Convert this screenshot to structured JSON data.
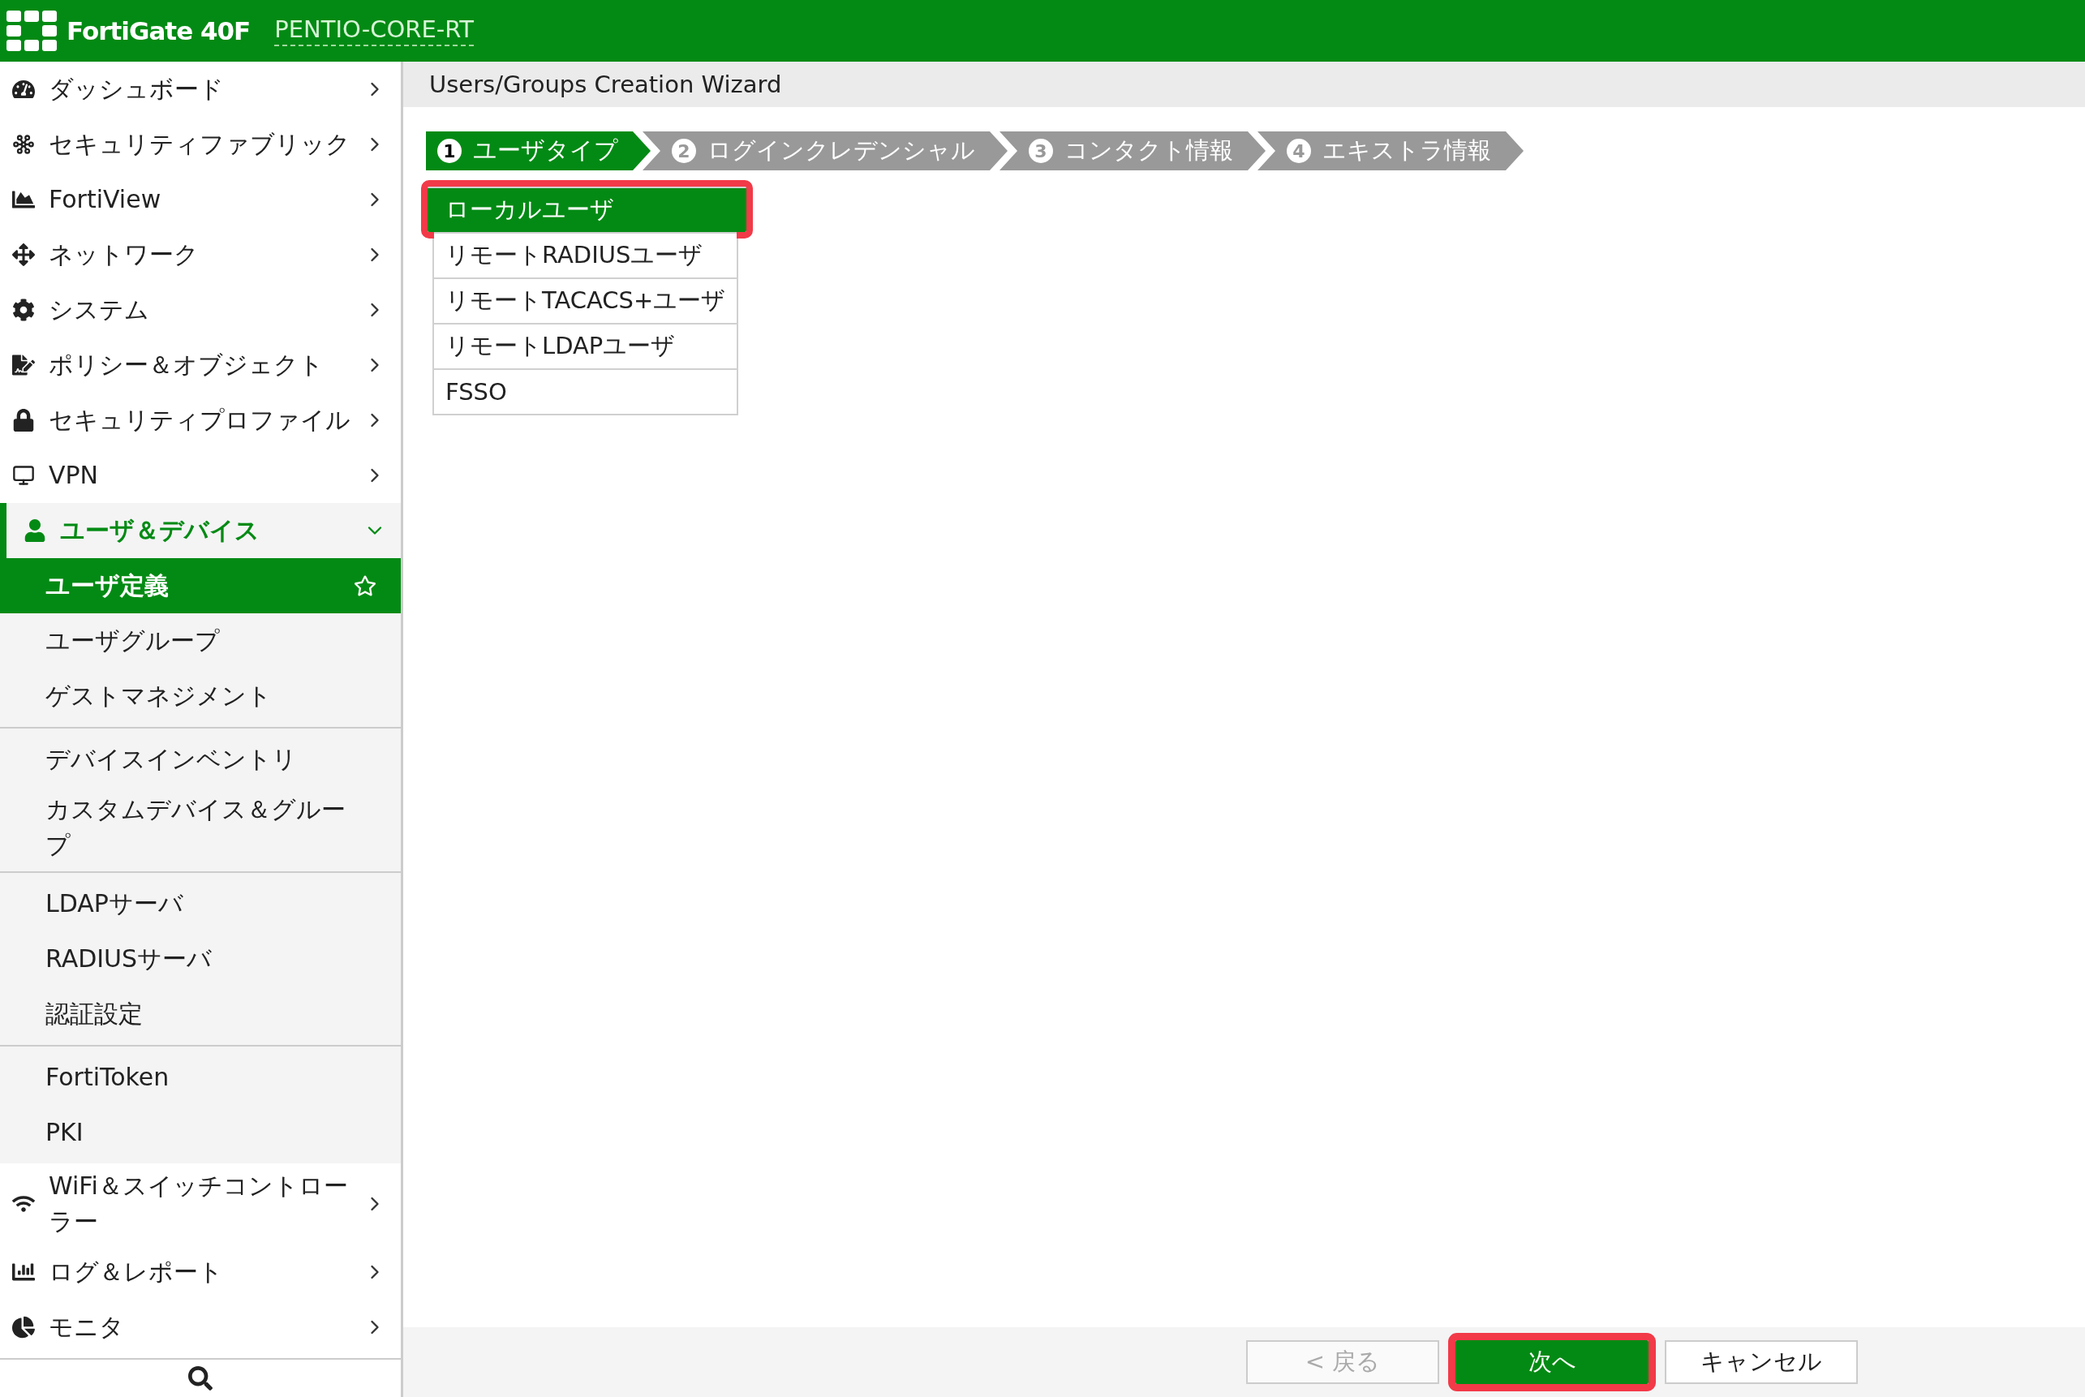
{
  "header": {
    "product": "FortiGate 40F",
    "hostname": "PENTIO-CORE-RT"
  },
  "sidebar": {
    "items": [
      {
        "label": "ダッシュボード",
        "expanded": false
      },
      {
        "label": "セキュリティファブリック",
        "expanded": false
      },
      {
        "label": "FortiView",
        "expanded": false
      },
      {
        "label": "ネットワーク",
        "expanded": false
      },
      {
        "label": "システム",
        "expanded": false
      },
      {
        "label": "ポリシー＆オブジェクト",
        "expanded": false
      },
      {
        "label": "セキュリティプロファイル",
        "expanded": false
      },
      {
        "label": "VPN",
        "expanded": false
      },
      {
        "label": "ユーザ＆デバイス",
        "expanded": true,
        "children": [
          [
            {
              "label": "ユーザ定義",
              "selected": true
            },
            {
              "label": "ユーザグループ",
              "selected": false
            },
            {
              "label": "ゲストマネジメント",
              "selected": false
            }
          ],
          [
            {
              "label": "デバイスインベントリ",
              "selected": false
            },
            {
              "label": "カスタムデバイス＆グループ",
              "selected": false
            }
          ],
          [
            {
              "label": "LDAPサーバ",
              "selected": false
            },
            {
              "label": "RADIUSサーバ",
              "selected": false
            },
            {
              "label": "認証設定",
              "selected": false
            }
          ],
          [
            {
              "label": "FortiToken",
              "selected": false
            },
            {
              "label": "PKI",
              "selected": false
            }
          ]
        ]
      },
      {
        "label": "WiFi＆スイッチコントローラー",
        "expanded": false
      },
      {
        "label": "ログ＆レポート",
        "expanded": false
      },
      {
        "label": "モニタ",
        "expanded": false
      }
    ]
  },
  "page_title": "Users/Groups Creation Wizard",
  "steps": [
    {
      "number": "1",
      "label": "ユーザタイプ",
      "selected": true
    },
    {
      "number": "2",
      "label": "ログインクレデンシャル",
      "selected": false
    },
    {
      "number": "3",
      "label": "コンタクト情報",
      "selected": false
    },
    {
      "number": "4",
      "label": "エキストラ情報",
      "selected": false
    }
  ],
  "user_types": [
    {
      "label": "ローカルユーザ",
      "selected": true,
      "highlighted": true
    },
    {
      "label": "リモートRADIUSユーザ",
      "selected": false,
      "highlighted": false
    },
    {
      "label": "リモートTACACS+ユーザ",
      "selected": false,
      "highlighted": false
    },
    {
      "label": "リモートLDAPユーザ",
      "selected": false,
      "highlighted": false
    },
    {
      "label": "FSSO",
      "selected": false,
      "highlighted": false
    }
  ],
  "buttons": [
    {
      "label": "< 戻る",
      "kind": "back",
      "disabled": true,
      "highlighted": false
    },
    {
      "label": "次へ",
      "kind": "primary",
      "disabled": false,
      "highlighted": true
    },
    {
      "label": "キャンセル",
      "kind": "secondary",
      "disabled": false,
      "highlighted": false
    }
  ]
}
